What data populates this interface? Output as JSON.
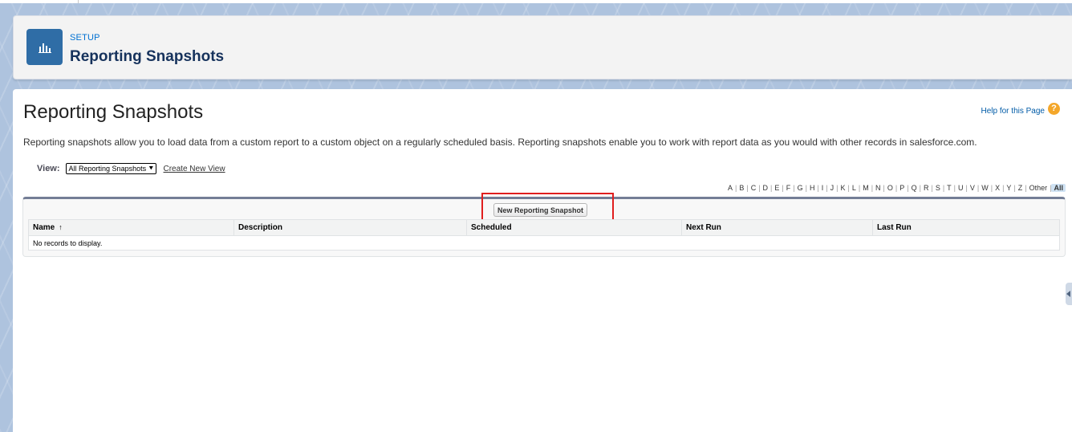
{
  "header": {
    "eyebrow": "SETUP",
    "title": "Reporting Snapshots",
    "icon": "bar-chart-icon"
  },
  "page": {
    "title": "Reporting Snapshots",
    "help_link": "Help for this Page",
    "help_icon": "?",
    "description": "Reporting snapshots allow you to load data from a custom report to a custom object on a regularly scheduled basis. Reporting snapshots enable you to work with report data as you would with other records in salesforce.com."
  },
  "view": {
    "label": "View:",
    "selected": "All Reporting Snapshots",
    "create_new": "Create New View"
  },
  "alphabet": [
    "A",
    "B",
    "C",
    "D",
    "E",
    "F",
    "G",
    "H",
    "I",
    "J",
    "K",
    "L",
    "M",
    "N",
    "O",
    "P",
    "Q",
    "R",
    "S",
    "T",
    "U",
    "V",
    "W",
    "X",
    "Y",
    "Z",
    "Other",
    "All"
  ],
  "alphabet_active": "All",
  "list": {
    "new_button": "New Reporting Snapshot",
    "columns": [
      "Name",
      "Description",
      "Scheduled",
      "Next Run",
      "Last Run"
    ],
    "sort_indicator": "↑",
    "empty_message": "No records to display."
  },
  "colors": {
    "brand": "#2f6da6",
    "link": "#0070d2",
    "highlight": "#e01e1e"
  }
}
